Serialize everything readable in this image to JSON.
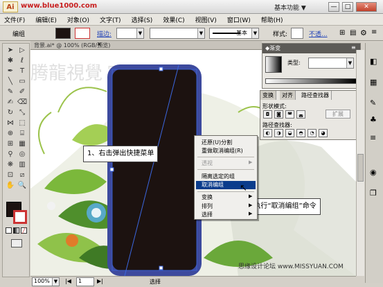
{
  "window": {
    "logo": "Ai",
    "watermark_url": "www.blue1000.com",
    "workspace": "基本功能 ▼",
    "controls": [
      "—",
      "□",
      "✕"
    ]
  },
  "menubar": [
    "文件(F)",
    "编辑(E)",
    "对象(O)",
    "文字(T)",
    "选择(S)",
    "效果(C)",
    "视图(V)",
    "窗口(W)",
    "帮助(H)"
  ],
  "control_bar": {
    "selection_label": "编组",
    "stroke_label": "描边:",
    "stroke_style": "基本",
    "style_label": "样式:",
    "opacity_link": "不透..."
  },
  "document": {
    "tab_label": "背景.ai* @ 100% (RGB/预览)",
    "zoom": "100%",
    "page": "1",
    "status_mode": "选择",
    "watermark_text": "腾龍視覺 TLVNET"
  },
  "gradient_panel": {
    "title": "◆渐变",
    "type_label": "类型:"
  },
  "pathfinder_panel": {
    "tabs": [
      "变换",
      "对齐",
      "路径查找器"
    ],
    "shape_modes_label": "形状模式:",
    "expand_button": "扩展",
    "pathfinders_label": "路径查找器:"
  },
  "context_menu": {
    "items": [
      {
        "label": "还原(U)分割",
        "disabled": false
      },
      {
        "label": "重做取消编组(R)",
        "disabled": false
      },
      {
        "label": "透视",
        "disabled": true
      },
      {
        "label": "隔离选定的组",
        "disabled": false
      },
      {
        "label": "取消编组",
        "disabled": false,
        "highlighted": true
      },
      {
        "label": "变换",
        "disabled": false
      },
      {
        "label": "排列",
        "disabled": false
      },
      {
        "label": "选择",
        "disabled": false
      }
    ]
  },
  "callouts": {
    "step1": "1、右击弹出快捷菜单",
    "step2": "2、执行“取消编组”命令"
  },
  "footer_watermark": "思缘设计论坛 www.MISSYUAN.COM",
  "colors": {
    "phone_body": "#1c1210",
    "phone_frame": "#3d4a9e",
    "selection": "#3b67e0",
    "menu_highlight": "#0b3c8c"
  }
}
